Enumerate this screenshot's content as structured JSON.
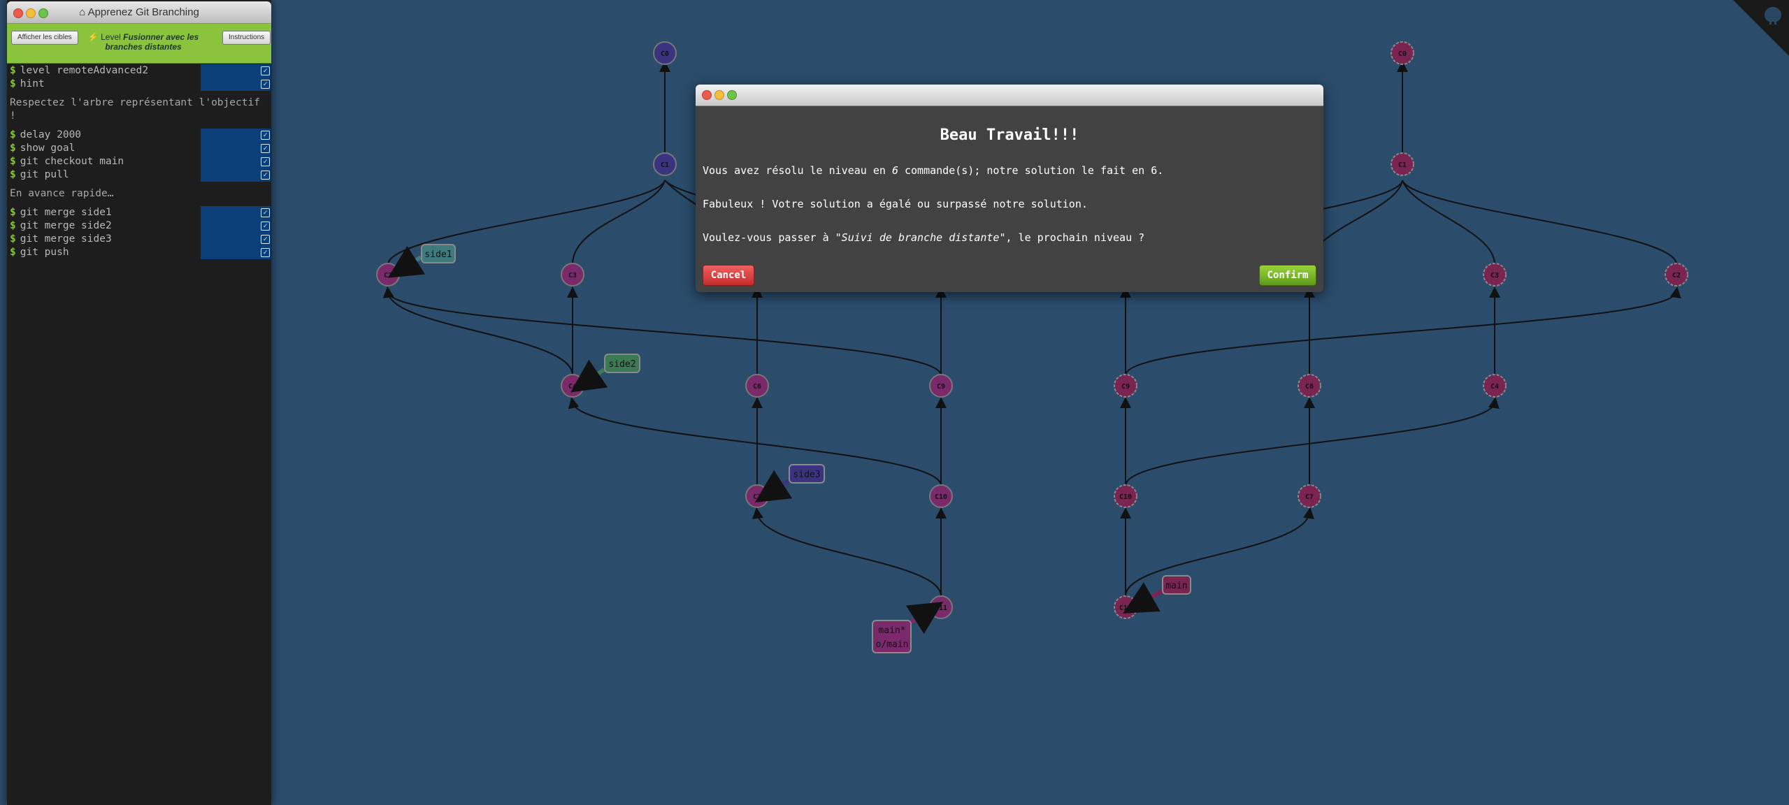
{
  "terminal": {
    "title": "Apprenez Git Branching",
    "show_goals_button": "Afficher les cibles",
    "instructions_button": "Instructions",
    "level_prefix": "Level",
    "level_name": "Fusionner avec les branches distantes",
    "group1": [
      "level remoteAdvanced2",
      "hint"
    ],
    "info1": "Respectez l'arbre représentant l'objectif !",
    "group2": [
      "delay 2000",
      "show goal",
      "git checkout main",
      "git pull"
    ],
    "info2": "En avance rapide…",
    "group3": [
      "git merge side1",
      "git merge side2",
      "git merge side3",
      "git push"
    ],
    "prompt_symbol": "$"
  },
  "dialog": {
    "heading": "Beau Travail!!!",
    "line1_before": "Vous avez résolu le niveau en ",
    "line1_count": "6",
    "line1_after": " commande(s); notre solution le fait en 6.",
    "line2": "Fabuleux ! Votre solution a égalé ou surpassé notre solution.",
    "line3_before": "Voulez-vous passer à ",
    "line3_level": "\"Suivi de branche distante\"",
    "line3_after": ", le prochain niveau ?",
    "cancel_label": "Cancel",
    "confirm_label": "Confirm"
  },
  "colors": {
    "background": "#2b4c6b",
    "local_commit": "#7a2a6a",
    "origin_commit": "#7a2452",
    "root_commit": "#3a3480",
    "accent_green": "#8ac43c"
  },
  "graph": {
    "local_commits": [
      "C0",
      "C1",
      "C2",
      "C3",
      "C4",
      "C6",
      "C7",
      "C9",
      "C10",
      "C11"
    ],
    "origin_commits": [
      "C0",
      "C1",
      "C2",
      "C3",
      "C4",
      "C6",
      "C7",
      "C9",
      "C10",
      "C11"
    ],
    "branches": {
      "side1": "side1",
      "side2": "side2",
      "side3": "side3",
      "main_local": "main*",
      "origin_main": "o/main",
      "main_remote": "main"
    }
  }
}
